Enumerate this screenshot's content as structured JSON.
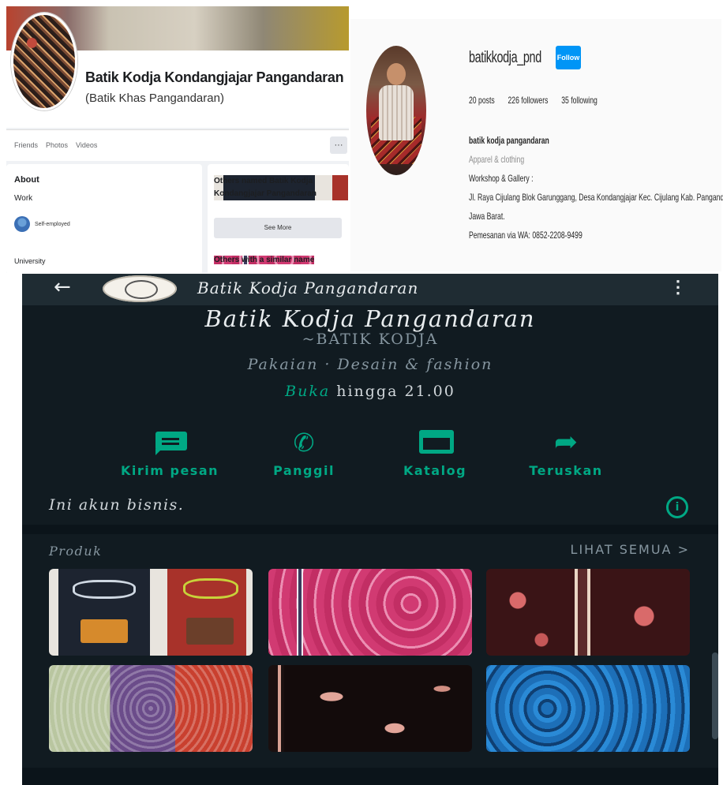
{
  "facebook": {
    "page_name": "Batik Kodja Kondangjajar Pangandaran",
    "page_subtitle": "(Batik Khas Pangandaran)",
    "tabs": [
      "Friends",
      "Photos",
      "Videos"
    ],
    "more_label": "···",
    "about": {
      "heading": "About",
      "work_label": "Work",
      "work_value": "Self-employed",
      "university_label": "University"
    },
    "others_named": "Others named Batik Kodja Kondangjajar Pangandaran",
    "see_more": "See More",
    "others_similar": "Others with a similar name"
  },
  "instagram": {
    "username": "batikkodja_pnd",
    "follow_label": "Follow",
    "posts": "20 posts",
    "followers": "226 followers",
    "following": "35 following",
    "bio_name": "batik kodja pangandaran",
    "bio_category": "Apparel & clothing",
    "bio_line1": "Workshop & Gallery :",
    "bio_line2": "Jl. Raya Cijulang Blok Garunggang, Desa Kondangjajar Kec. Cijulang Kab. Pangandaran",
    "bio_line3": "Jawa Barat.",
    "bio_line4": "Pemesanan via WA: 0852-2208-9499"
  },
  "whatsapp": {
    "back_icon": "←",
    "bar_title": "Batik Kodja Pangandaran",
    "menu_icon": "⋮",
    "business_name": "Batik Kodja Pangandaran",
    "business_subtitle": "~BATIK KODJA",
    "category": "Pakaian · Desain & fashion",
    "hours_status": "Buka",
    "hours_text": " hingga 21.00",
    "actions": [
      {
        "label": "Kirim pesan",
        "icon": "message-icon"
      },
      {
        "label": "Panggil",
        "icon": "phone-icon"
      },
      {
        "label": "Katalog",
        "icon": "catalog-icon"
      },
      {
        "label": "Teruskan",
        "icon": "forward-icon"
      }
    ],
    "call_glyph": "✆",
    "forward_glyph": "➦",
    "business_note": "Ini akun bisnis.",
    "info_glyph": "i",
    "products_title": "Produk",
    "see_all": "LIHAT SEMUA >",
    "accent_color": "#00a884"
  }
}
